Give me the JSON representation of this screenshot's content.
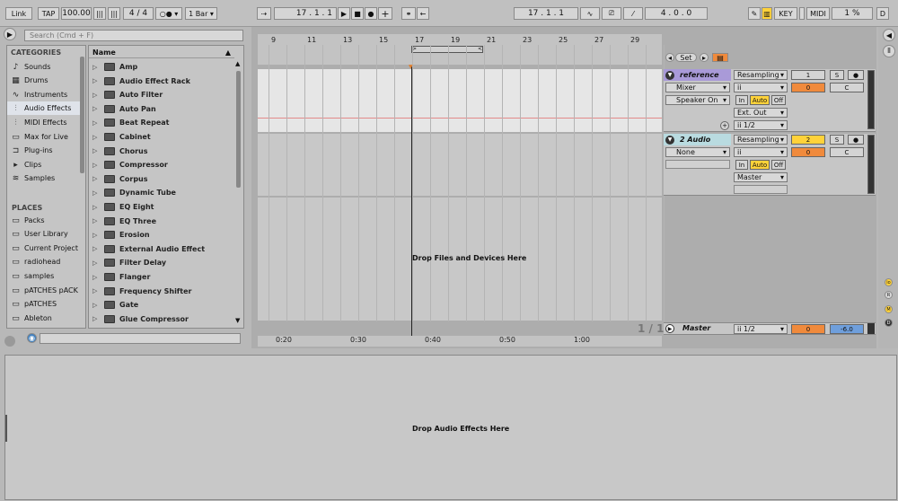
{
  "transport": {
    "link": "Link",
    "tap": "TAP",
    "tempo": "100.00",
    "meter_num": "4",
    "meter_sep": "/",
    "meter_den": "4",
    "quantize": "1 Bar",
    "position": "17 . 1 . 1",
    "loop_start": "17 . 1 . 1",
    "loop_length": "4 . 0 . 0",
    "key": "KEY",
    "midi": "MIDI",
    "cpu": "1 %",
    "d": "D"
  },
  "browser": {
    "search_placeholder": "Search (Cmd + F)",
    "categories_header": "CATEGORIES",
    "categories": [
      "Sounds",
      "Drums",
      "Instruments",
      "Audio Effects",
      "MIDI Effects",
      "Max for Live",
      "Plug-ins",
      "Clips",
      "Samples"
    ],
    "places_header": "PLACES",
    "places": [
      "Packs",
      "User Library",
      "Current Project",
      "radiohead",
      "samples",
      "pATCHES pACK",
      "pATCHES",
      "Ableton"
    ],
    "name_header": "Name",
    "items": [
      "Amp",
      "Audio Effect Rack",
      "Auto Filter",
      "Auto Pan",
      "Beat Repeat",
      "Cabinet",
      "Chorus",
      "Compressor",
      "Corpus",
      "Dynamic Tube",
      "EQ Eight",
      "EQ Three",
      "Erosion",
      "External Audio Effect",
      "Filter Delay",
      "Flanger",
      "Frequency Shifter",
      "Gate",
      "Glue Compressor"
    ]
  },
  "arrangement": {
    "bars": [
      "9",
      "11",
      "13",
      "15",
      "17",
      "19",
      "21",
      "23",
      "25",
      "27",
      "29"
    ],
    "time_marks": [
      "0:20",
      "0:30",
      "0:40",
      "0:50",
      "1:00"
    ],
    "drop_files": "Drop Files and Devices Here",
    "zoom": "1 / 1",
    "set_label": "Set"
  },
  "tracks": [
    {
      "name": "reference",
      "input": "Resampling",
      "routing": "Mixer",
      "output_target": "Speaker On",
      "out_type": "Ext. Out",
      "out_chan": "ii 1/2",
      "number": "1",
      "volume": "0",
      "pan": "C",
      "color": "#a99ad8"
    },
    {
      "name": "2 Audio",
      "input": "Resampling",
      "routing": "None",
      "out_type": "Master",
      "number": "2",
      "volume": "0",
      "pan": "C",
      "color": "#b9dbe0"
    }
  ],
  "monitor": {
    "in": "In",
    "auto": "Auto",
    "off": "Off",
    "solo": "S"
  },
  "master": {
    "name": "Master",
    "out": "ii 1/2",
    "volume": "0",
    "level": "-6.0"
  },
  "side_letters": {
    "m": "M",
    "d": "D"
  },
  "device_view": {
    "drop": "Drop Audio Effects Here"
  }
}
